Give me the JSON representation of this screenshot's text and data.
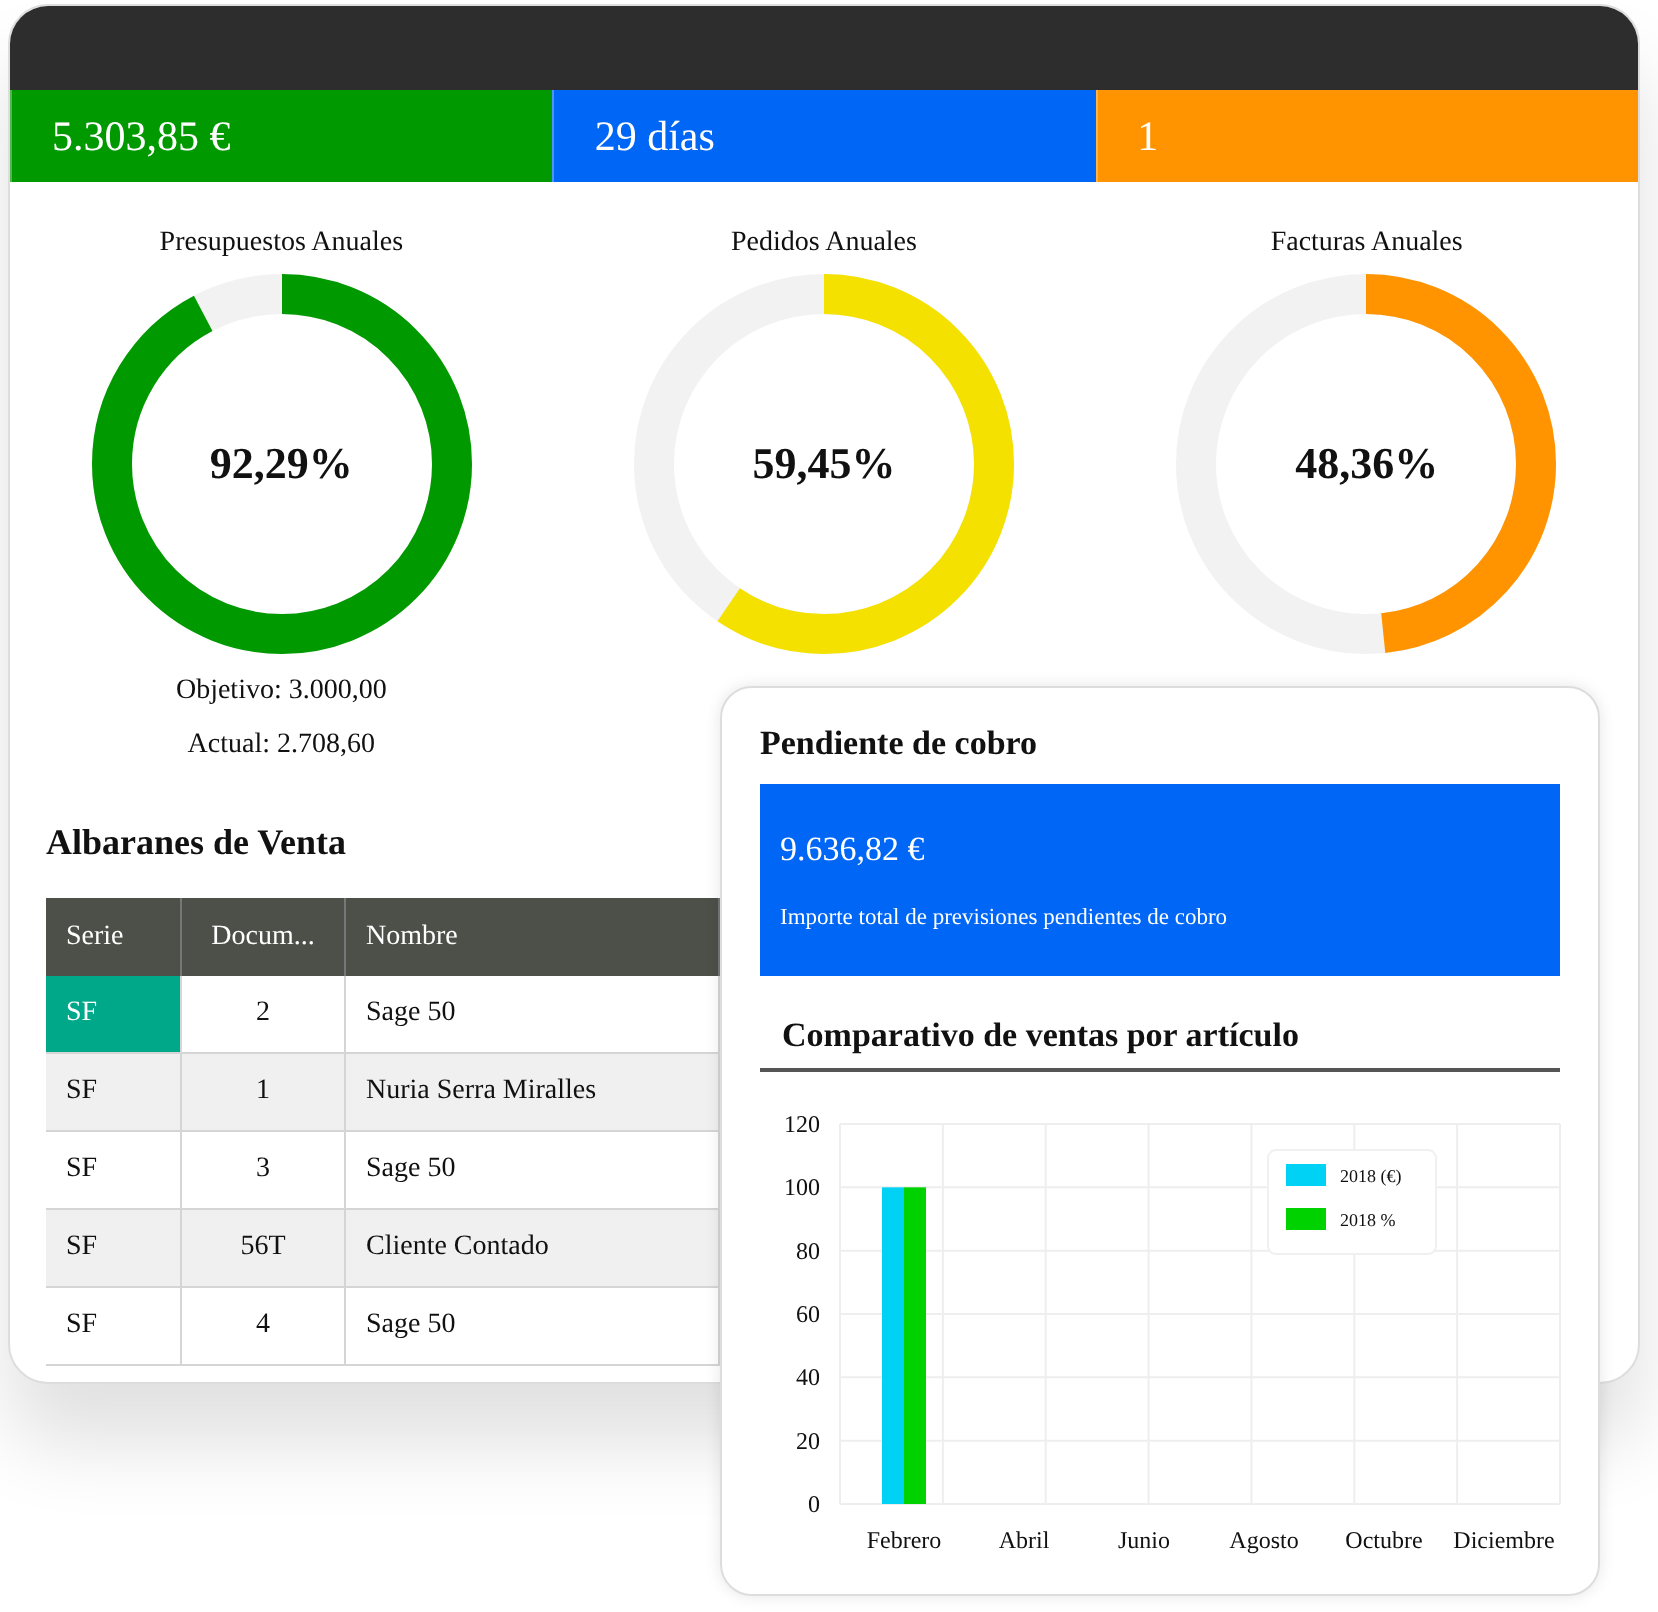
{
  "stats": [
    {
      "value": "5.303,85 €",
      "color": "#009a00"
    },
    {
      "value": "29 días",
      "color": "#0066f5"
    },
    {
      "value": "1",
      "color": "#ff9400"
    }
  ],
  "donuts": [
    {
      "title": "Presupuestos Anuales",
      "percent": "92,29%",
      "level": 0.9229,
      "color": "#009a00",
      "objective": "Objetivo: 3.000,00",
      "actual": "Actual: 2.708,60"
    },
    {
      "title": "Pedidos Anuales",
      "percent": "59,45%",
      "level": 0.5945,
      "color": "#f5e100"
    },
    {
      "title": "Facturas Anuales",
      "percent": "48,36%",
      "level": 0.4836,
      "color": "#ff9400"
    }
  ],
  "table": {
    "title": "Albaranes de Venta",
    "columns": [
      "Serie",
      "Docum...",
      "Nombre"
    ],
    "rows": [
      {
        "cells": [
          "SF",
          "2",
          "Sage 50"
        ],
        "selected": true
      },
      {
        "cells": [
          "SF",
          "1",
          "Nuria Serra Miralles"
        ],
        "selected": false
      },
      {
        "cells": [
          "SF",
          "3",
          "Sage 50"
        ],
        "selected": false
      },
      {
        "cells": [
          "SF",
          "56T",
          "Cliente Contado"
        ],
        "selected": false
      },
      {
        "cells": [
          "SF",
          "4",
          "Sage 50"
        ],
        "selected": false
      }
    ]
  },
  "pending": {
    "title": "Pendiente de cobro",
    "amount": "9.636,82 €",
    "caption": "Importe total de previsiones pendientes de cobro",
    "chart_title": "Comparativo de ventas por artículo",
    "chart_data": {
      "type": "bar",
      "categories": [
        "Febrero",
        "Abril",
        "Junio",
        "Agosto",
        "Octubre",
        "Diciembre"
      ],
      "series": [
        {
          "name": "2018 (€)",
          "color": "#00d2f5",
          "values": [
            100,
            0,
            0,
            0,
            0,
            0
          ]
        },
        {
          "name": "2018 %",
          "color": "#00d200",
          "values": [
            100,
            0,
            0,
            0,
            0,
            0
          ]
        }
      ],
      "grid": true,
      "legend": true,
      "ylim": [
        0,
        120
      ],
      "yticks": [
        0,
        20,
        40,
        60,
        80,
        100,
        120
      ]
    }
  }
}
